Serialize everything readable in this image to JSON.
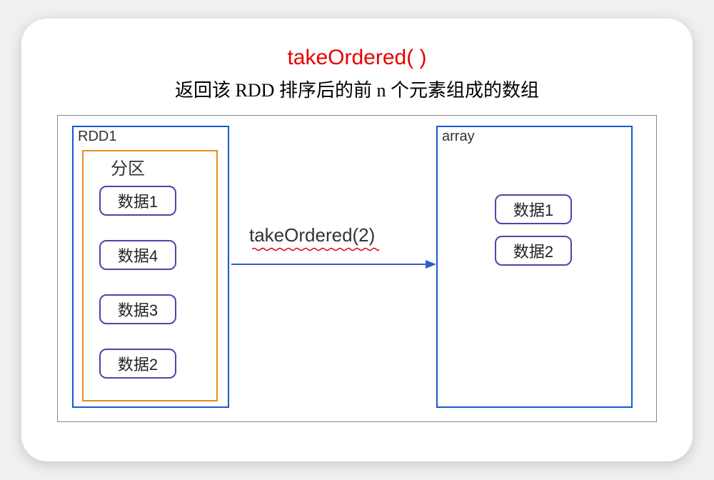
{
  "title": "takeOrdered( )",
  "subtitle": "返回该 RDD 排序后的前 n 个元素组成的数组",
  "diagram": {
    "rdd_label": "RDD1",
    "partition_label": "分区",
    "data_items": [
      "数据1",
      "数据4",
      "数据3",
      "数据2"
    ],
    "array_label": "array",
    "array_items": [
      "数据1",
      "数据2"
    ],
    "operation_label": "takeOrdered(2)"
  }
}
